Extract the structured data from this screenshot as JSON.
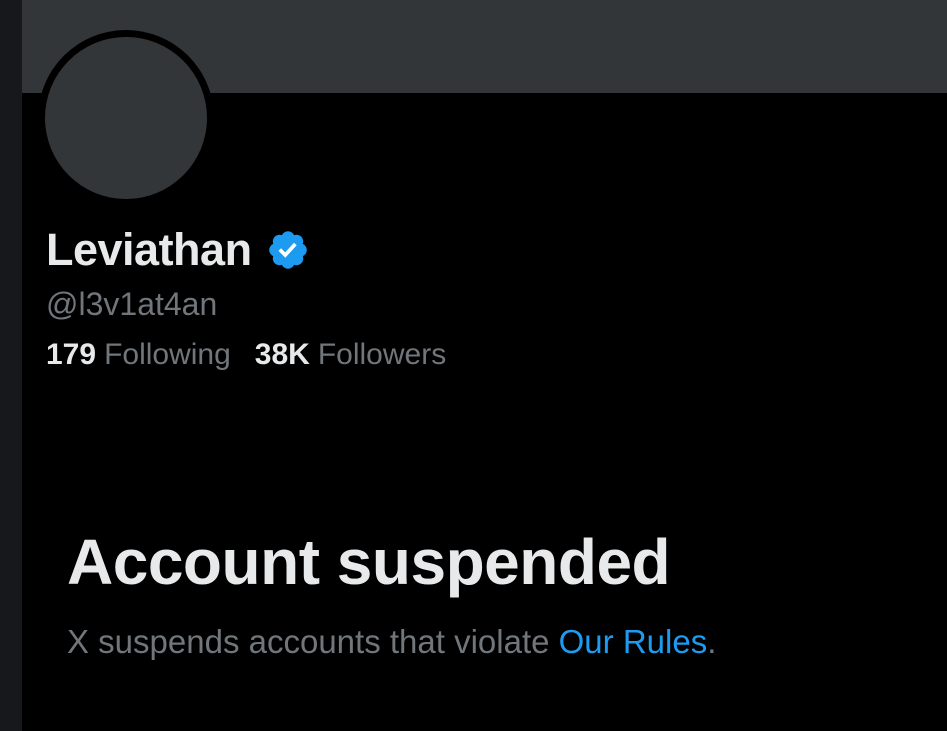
{
  "profile": {
    "display_name": "Leviathan",
    "verified": true,
    "verified_icon": "verified-badge-icon",
    "handle": "@l3v1at4an",
    "following_count": "179",
    "following_label": "Following",
    "followers_count": "38K",
    "followers_label": "Followers"
  },
  "suspension": {
    "title": "Account suspended",
    "message_prefix": "X suspends accounts that violate ",
    "rules_link": "Our Rules",
    "message_suffix": "."
  },
  "colors": {
    "background": "#000000",
    "banner": "#333639",
    "primary_text": "#e7e9ea",
    "secondary_text": "#71767b",
    "accent": "#1d9bf0"
  }
}
